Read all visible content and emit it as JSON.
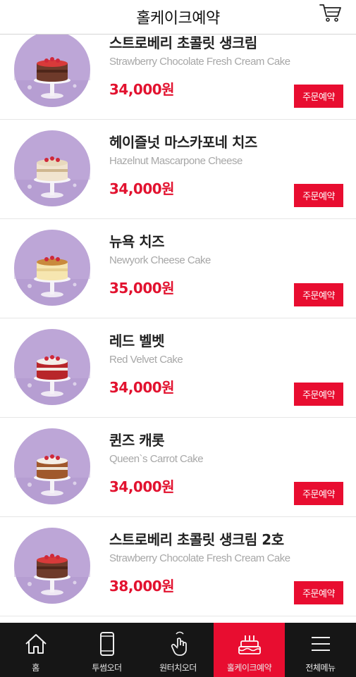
{
  "header": {
    "title": "홀케이크예약",
    "cart_icon": "cart-icon"
  },
  "products": [
    {
      "name": "스트로베리 초콜릿 생크림",
      "name_en": "Strawberry Chocolate Fresh Cream Cake",
      "price": "34,000원",
      "order_label": "주문예약",
      "cake": "strawberry"
    },
    {
      "name": "헤이즐넛 마스카포네 치즈",
      "name_en": "Hazelnut Mascarpone Cheese",
      "price": "34,000원",
      "order_label": "주문예약",
      "cake": "hazelnut"
    },
    {
      "name": "뉴욕 치즈",
      "name_en": "Newyork Cheese Cake",
      "price": "35,000원",
      "order_label": "주문예약",
      "cake": "cheese"
    },
    {
      "name": "레드 벨벳",
      "name_en": "Red Velvet Cake",
      "price": "34,000원",
      "order_label": "주문예약",
      "cake": "redvelvet"
    },
    {
      "name": "퀸즈 캐롯",
      "name_en": "Queen`s Carrot Cake",
      "price": "34,000원",
      "order_label": "주문예약",
      "cake": "carrot"
    },
    {
      "name": "스트로베리 초콜릿 생크림 2호",
      "name_en": "Strawberry Chocolate Fresh Cream Cake",
      "price": "38,000원",
      "order_label": "주문예약",
      "cake": "strawberry"
    }
  ],
  "nav": [
    {
      "label": "홈",
      "icon": "home-icon",
      "active": false
    },
    {
      "label": "투썸오더",
      "icon": "phone-icon",
      "active": false
    },
    {
      "label": "원터치오더",
      "icon": "touch-icon",
      "active": false
    },
    {
      "label": "홀케이크예약",
      "icon": "cake-icon",
      "active": true
    },
    {
      "label": "전체메뉴",
      "icon": "menu-icon",
      "active": false
    }
  ],
  "colors": {
    "accent": "#e80d30",
    "price": "#e2122f",
    "nav_bg": "#161616",
    "thumb_bg": "#b9a2d4"
  }
}
